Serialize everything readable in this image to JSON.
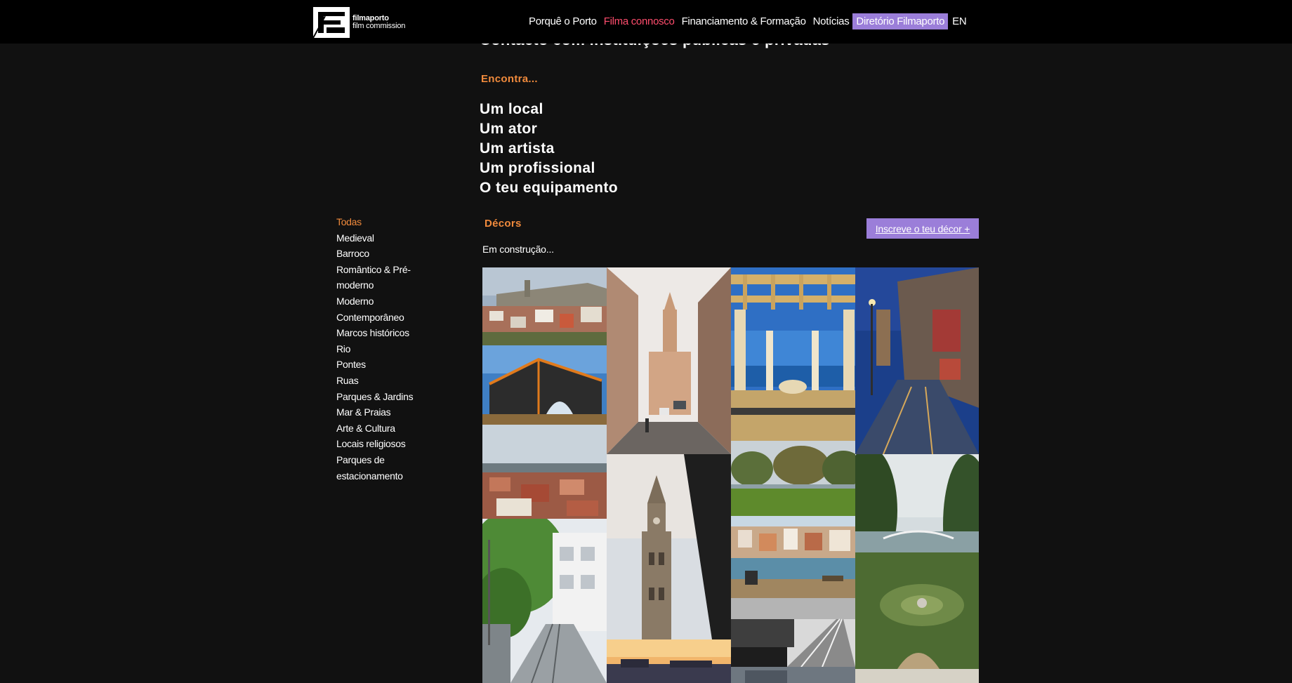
{
  "brand": {
    "name": "filmaporto",
    "tagline": "film commission"
  },
  "nav": {
    "items": [
      {
        "label": "Porquê o Porto",
        "state": "normal"
      },
      {
        "label": "Filma connosco",
        "state": "active"
      },
      {
        "label": "Financiamento & Formação",
        "state": "normal"
      },
      {
        "label": "Notícias",
        "state": "normal"
      },
      {
        "label": "Diretório Filmaporto",
        "state": "highlight"
      },
      {
        "label": "EN",
        "state": "lang"
      }
    ]
  },
  "hero": {
    "cutoff_heading": "Contacto com instituições públicas e privadas",
    "encontra_label": "Encontra...",
    "find_items": [
      "Um local",
      "Um ator",
      "Um artista",
      "Um profissional",
      "O teu equipamento"
    ]
  },
  "filters": {
    "selected": "Todas",
    "items": [
      "Todas",
      "Medieval",
      "Barroco",
      "Romântico & Pré-",
      "moderno",
      "Moderno",
      "Contemporâneo",
      "Marcos históricos",
      "Rio",
      "Pontes",
      "Ruas",
      "Parques & Jardins",
      "Mar & Praias",
      "Arte & Cultura",
      "Locais religiosos",
      "Parques de",
      "estacionamento"
    ]
  },
  "decors": {
    "title": "Décors",
    "cta_label": "Inscreve o teu décor +",
    "status_text": "Em construção..."
  },
  "gallery": {
    "photos": [
      {
        "name": "photo-medieval-walls",
        "subject": "medieval walls over hillside houses"
      },
      {
        "name": "photo-modern-building",
        "subject": "modern building with orange frame and fountain"
      },
      {
        "name": "photo-city-rooftops",
        "subject": "red rooftops of the city and river"
      },
      {
        "name": "photo-tree-street",
        "subject": "tree-lined street with tram tracks"
      },
      {
        "name": "photo-clerigos-street",
        "subject": "street leading to Clérigos church"
      },
      {
        "name": "photo-clerigos-tower",
        "subject": "Clérigos bell tower"
      },
      {
        "name": "photo-sunset-river",
        "subject": "sunset over the river"
      },
      {
        "name": "photo-pergola-sea",
        "subject": "pergola overlooking the sea"
      },
      {
        "name": "photo-park-lawn",
        "subject": "park lawn with trees"
      },
      {
        "name": "photo-ribeira-view",
        "subject": "view of Ribeira from the riverbank"
      },
      {
        "name": "photo-bridge-mist",
        "subject": "bridge in black and white mist"
      },
      {
        "name": "photo-wet-street",
        "subject": "rainy street at dusk with lamps"
      },
      {
        "name": "photo-garden-bridge",
        "subject": "formal garden with bridge in distance"
      }
    ]
  },
  "colors": {
    "background": "#111111",
    "header": "#000000",
    "accent_orange": "#f08a3c",
    "accent_pink": "#ff4d6d",
    "accent_purple": "#9b7ed9"
  }
}
